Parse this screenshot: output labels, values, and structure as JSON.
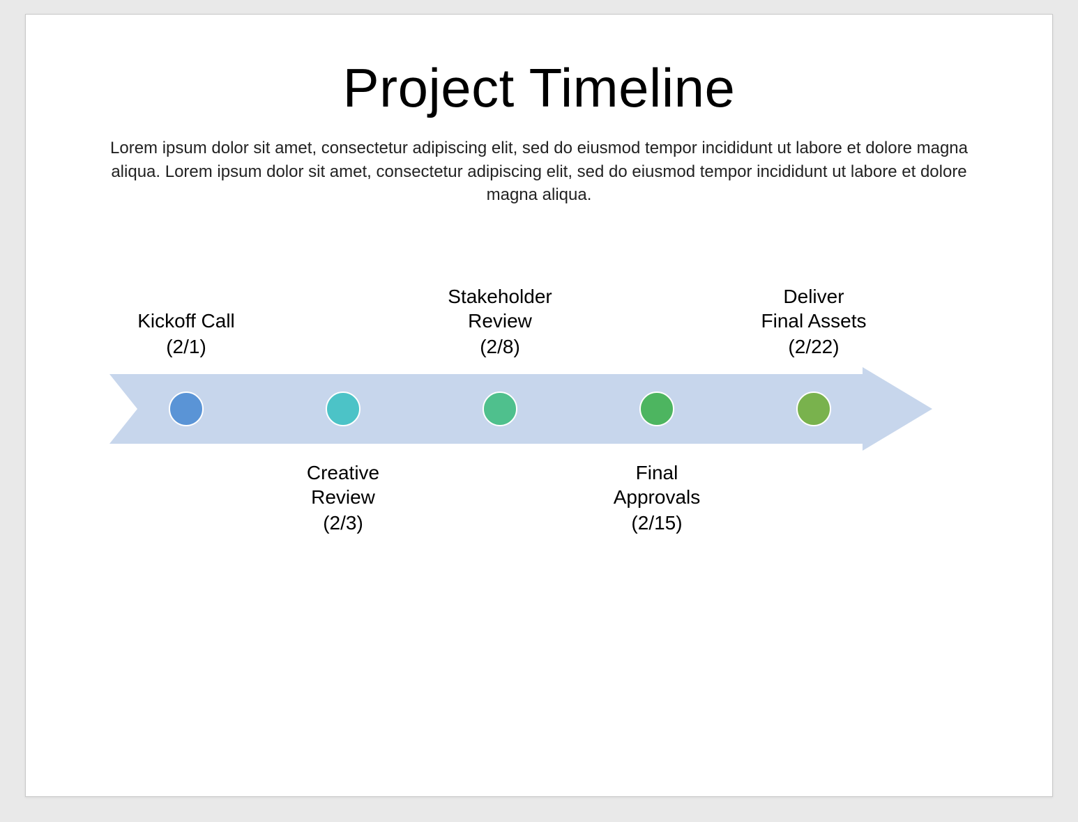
{
  "slide": {
    "title": "Project Timeline",
    "subtitle": "Lorem ipsum dolor sit amet, consectetur adipiscing elit, sed do eiusmod tempor incididunt ut labore et dolore magna aliqua. Lorem ipsum dolor sit amet, consectetur adipiscing elit, sed do eiusmod tempor incididunt ut labore et dolore magna aliqua."
  },
  "arrow_color": "#c7d6ec",
  "milestones": [
    {
      "label": "Kickoff Call",
      "date": "(2/1)",
      "position": "above",
      "color": "#5a94d6"
    },
    {
      "label": "Creative\nReview",
      "date": "(2/3)",
      "position": "below",
      "color": "#4cc3c7"
    },
    {
      "label": "Stakeholder\nReview",
      "date": "(2/8)",
      "position": "above",
      "color": "#4fc08d"
    },
    {
      "label": "Final\nApprovals",
      "date": "(2/15)",
      "position": "below",
      "color": "#4db560"
    },
    {
      "label": "Deliver\nFinal Assets",
      "date": "(2/22)",
      "position": "above",
      "color": "#79b24d"
    }
  ]
}
